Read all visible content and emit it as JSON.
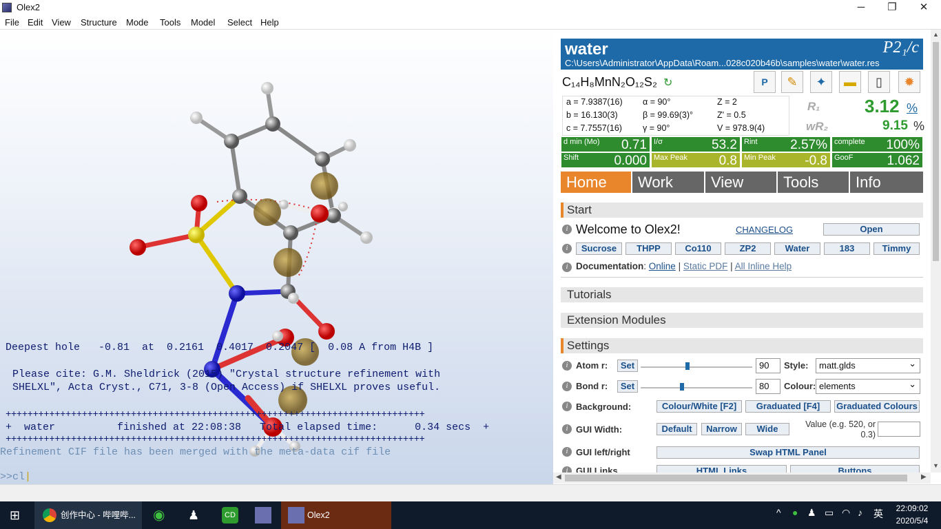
{
  "window": {
    "title": "Olex2",
    "min": "─",
    "max": "❐",
    "close": "✕"
  },
  "menu": [
    "File",
    "Edit",
    "View",
    "Structure",
    "Mode",
    "Tools",
    "Model",
    "Select",
    "Help"
  ],
  "console": {
    "deepest_hole": "Deepest hole   -0.81  at  0.2161  0.4017  0.2047 [  0.08 A from H4B ]",
    "cite1": "  Please cite: G.M. Sheldrick (2015) \"Crystal structure refinement with",
    "cite2": "  SHELXL\", Acta Cryst., C71, 3-8 (Open Access) if SHELXL proves useful.",
    "sep1": "+++++++++++++++++++++++++++++++++++++++++++++++++++++++++++++++++++++++++++++",
    "finished": "+  water          finished at 22:08:38   Total elapsed time:      0.34 secs  +",
    "sep2": "+++++++++++++++++++++++++++++++++++++++++++++++++++++++++++++++++++++++++++++",
    "merged": "Refinement CIF file has been merged with the meta-data cif file",
    "prompt": ">>cl"
  },
  "header": {
    "name": "water",
    "space_group": "P2₁/c",
    "path": "C:\\Users\\Administrator\\AppData\\Roam...028c020b46b\\samples\\water\\water.res",
    "formula": "C₁₄H₈MnN₂O₁₂S₂"
  },
  "cell": {
    "a": "a = 7.9387(16)",
    "b": "b = 16.130(3)",
    "c": "c = 7.7557(16)",
    "alpha": "α = 90°",
    "beta": "β = 99.69(3)°",
    "gamma": "γ = 90°",
    "Z": "Z = 2",
    "Zp": "Z' = 0.5",
    "V": "V = 978.9(4)"
  },
  "r": {
    "r1_label": "R₁",
    "r1": "3.12",
    "wr2_label": "wR₂",
    "wr2": "9.15",
    "pct": "%"
  },
  "stats": [
    {
      "label": "d min (Mo)",
      "value": "0.71",
      "color": "#2e8b2e"
    },
    {
      "label": "I/σ",
      "value": "53.2",
      "color": "#2e8b2e"
    },
    {
      "label": "Rint",
      "value": "2.57%",
      "color": "#2e8b2e"
    },
    {
      "label": "complete",
      "value": "100%",
      "color": "#2e8b2e"
    },
    {
      "label": "Shift",
      "value": "0.000",
      "color": "#2e8b2e"
    },
    {
      "label": "Max Peak",
      "value": "0.8",
      "color": "#a9b52a"
    },
    {
      "label": "Min Peak",
      "value": "-0.8",
      "color": "#a9b52a"
    },
    {
      "label": "GooF",
      "value": "1.062",
      "color": "#2e8b2e"
    }
  ],
  "tabs": [
    "Home",
    "Work",
    "View",
    "Tools",
    "Info"
  ],
  "start": {
    "title": "Start",
    "welcome": "Welcome to Olex2!",
    "changelog": "CHANGELOG",
    "open": "Open",
    "samples": [
      "Sucrose",
      "THPP",
      "Co110",
      "ZP2",
      "Water",
      "183",
      "Timmy"
    ],
    "doc_label": "Documentation",
    "doc_online": "Online",
    "doc_pdf": "Static PDF",
    "doc_help": "All Inline Help"
  },
  "sections": {
    "tutorials": "Tutorials",
    "extensions": "Extension Modules",
    "settings": "Settings"
  },
  "settings": {
    "atom_r": "Atom r:",
    "set": "Set",
    "atom_val": "90",
    "style_label": "Style:",
    "style_val": "matt.glds",
    "bond_r": "Bond r:",
    "bond_val": "80",
    "colour_label": "Colour:",
    "colour_val": "elements",
    "background": "Background:",
    "bg1": "Colour/White [F2]",
    "bg2": "Graduated [F4]",
    "bg3": "Graduated Colours",
    "gui_width": "GUI Width:",
    "w1": "Default",
    "w2": "Narrow",
    "w3": "Wide",
    "value_hint": "Value (e.g. 520, or 0.3)",
    "gui_lr": "GUI left/right",
    "swap": "Swap HTML Panel",
    "gui_links": "GUI Links",
    "html_links": "HTML Links",
    "buttons": "Buttons"
  },
  "taskbar": {
    "chrome": "创作中心 - 哔哩哔...",
    "olex": "Olex2",
    "ime": "英",
    "time": "22:09:02",
    "date": "2020/5/4"
  }
}
